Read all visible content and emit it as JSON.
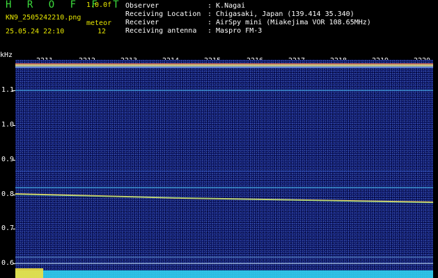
{
  "header": {
    "app_title": "H R O F F T",
    "version": "1.0.0f",
    "filename": "KN9_2505242210.png",
    "timestamp": "25.05.24 22:10",
    "meteor_label": "meteor",
    "meteor_count": "12"
  },
  "info": [
    {
      "label": "Observer",
      "value": ": K.Nagai"
    },
    {
      "label": "Receiving Location",
      "value": ": Chigasaki, Japan (139.414 35.340)"
    },
    {
      "label": "Receiver",
      "value": ": AirSpy mini (Miakejima VOR 108.65MHz)"
    },
    {
      "label": "Receiving antenna",
      "value": ": Maspro FM-3"
    }
  ],
  "axes": {
    "y_unit": "kHz",
    "y_ticks": [
      "1.1",
      "1.0",
      "0.9",
      "0.8",
      "0.7",
      "0.6"
    ],
    "x_ticks": [
      "2211",
      "2212",
      "2213",
      "2214",
      "2215",
      "2216",
      "2217",
      "2218",
      "2219",
      "2220"
    ]
  },
  "colors": {
    "title": "#3cdc3c",
    "meta": "#e8e800",
    "background": "#0a1360",
    "signal": "#ffd23c"
  }
}
